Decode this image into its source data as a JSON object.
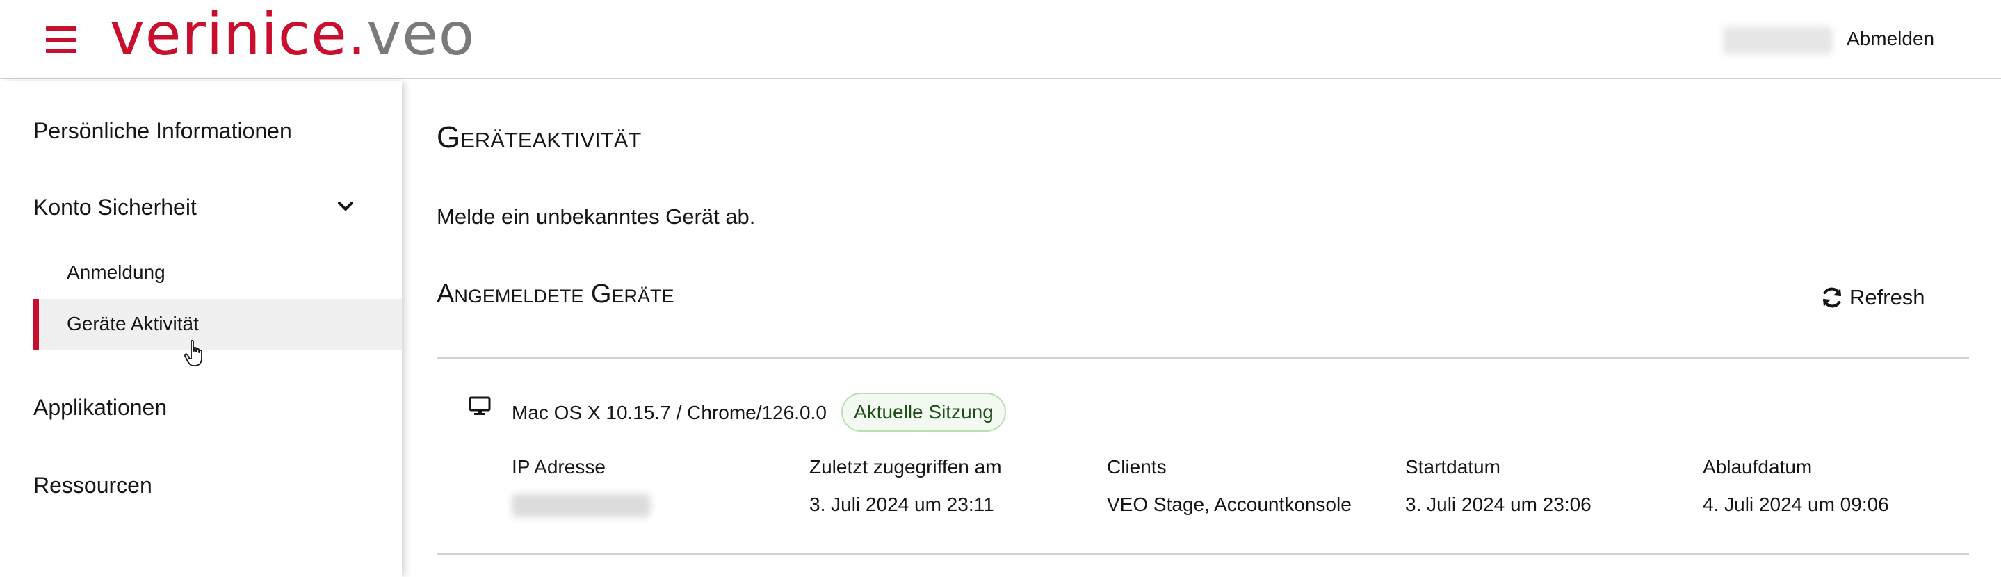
{
  "header": {
    "logo_brand": "verinice",
    "logo_dot": ".",
    "logo_product": "veo",
    "logout_label": "Abmelden",
    "accent_color": "#c8102e"
  },
  "sidebar": {
    "items": [
      {
        "label": "Persönliche Informationen"
      },
      {
        "label": "Konto Sicherheit",
        "expanded": true,
        "icon": "chevron-down-icon"
      },
      {
        "label": "Anmeldung"
      },
      {
        "label": "Geräte Aktivität",
        "active": true
      },
      {
        "label": "Applikationen"
      },
      {
        "label": "Ressourcen"
      }
    ]
  },
  "main": {
    "title": "Geräteaktivität",
    "description": "Melde ein unbekanntes Gerät ab.",
    "subtitle": "Angemeldete Geräte",
    "refresh_label": "Refresh",
    "refresh_icon": "refresh-icon",
    "device": {
      "icon": "desktop-icon",
      "name": "Mac OS X 10.15.7 / Chrome/126.0.0",
      "badge": "Aktuelle Sitzung",
      "columns": [
        {
          "header": "IP Adresse",
          "value": ""
        },
        {
          "header": "Zuletzt zugegriffen am",
          "value": "3. Juli 2024 um 23:11"
        },
        {
          "header": "Clients",
          "value": "VEO Stage, Accountkonsole"
        },
        {
          "header": "Startdatum",
          "value": "3. Juli 2024 um 23:06"
        },
        {
          "header": "Ablaufdatum",
          "value": "4. Juli 2024 um 09:06"
        }
      ]
    }
  }
}
